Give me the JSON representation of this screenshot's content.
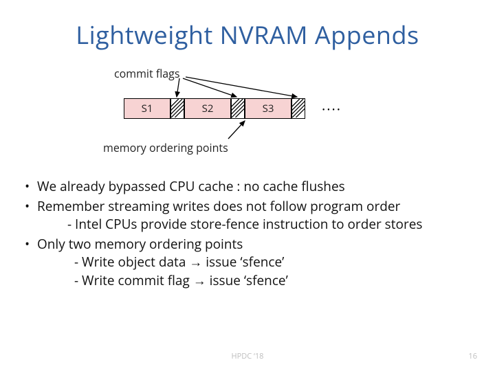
{
  "title": "Lightweight NVRAM Appends",
  "labels": {
    "commit_flags": "commit flags",
    "memory_ordering": "memory ordering points"
  },
  "segments": [
    "S1",
    "S2",
    "S3"
  ],
  "ellipsis": "····",
  "bullets": {
    "b1_pre": "We already bypassed CPU cache : ",
    "b1_bold": "no  cache flushes",
    "b2": "Remember streaming writes does not follow program order",
    "b2_sub": "- Intel CPUs provide store-fence instruction to order stores",
    "b3_pre": "Only ",
    "b3_bold": "two memory ordering points",
    "b3_sub1": "-   Write object data → issue ‘sfence’",
    "b3_sub2": "-   Write commit flag → issue ‘sfence’"
  },
  "footer": {
    "conference": "HPDC ‘18",
    "page": "16"
  }
}
